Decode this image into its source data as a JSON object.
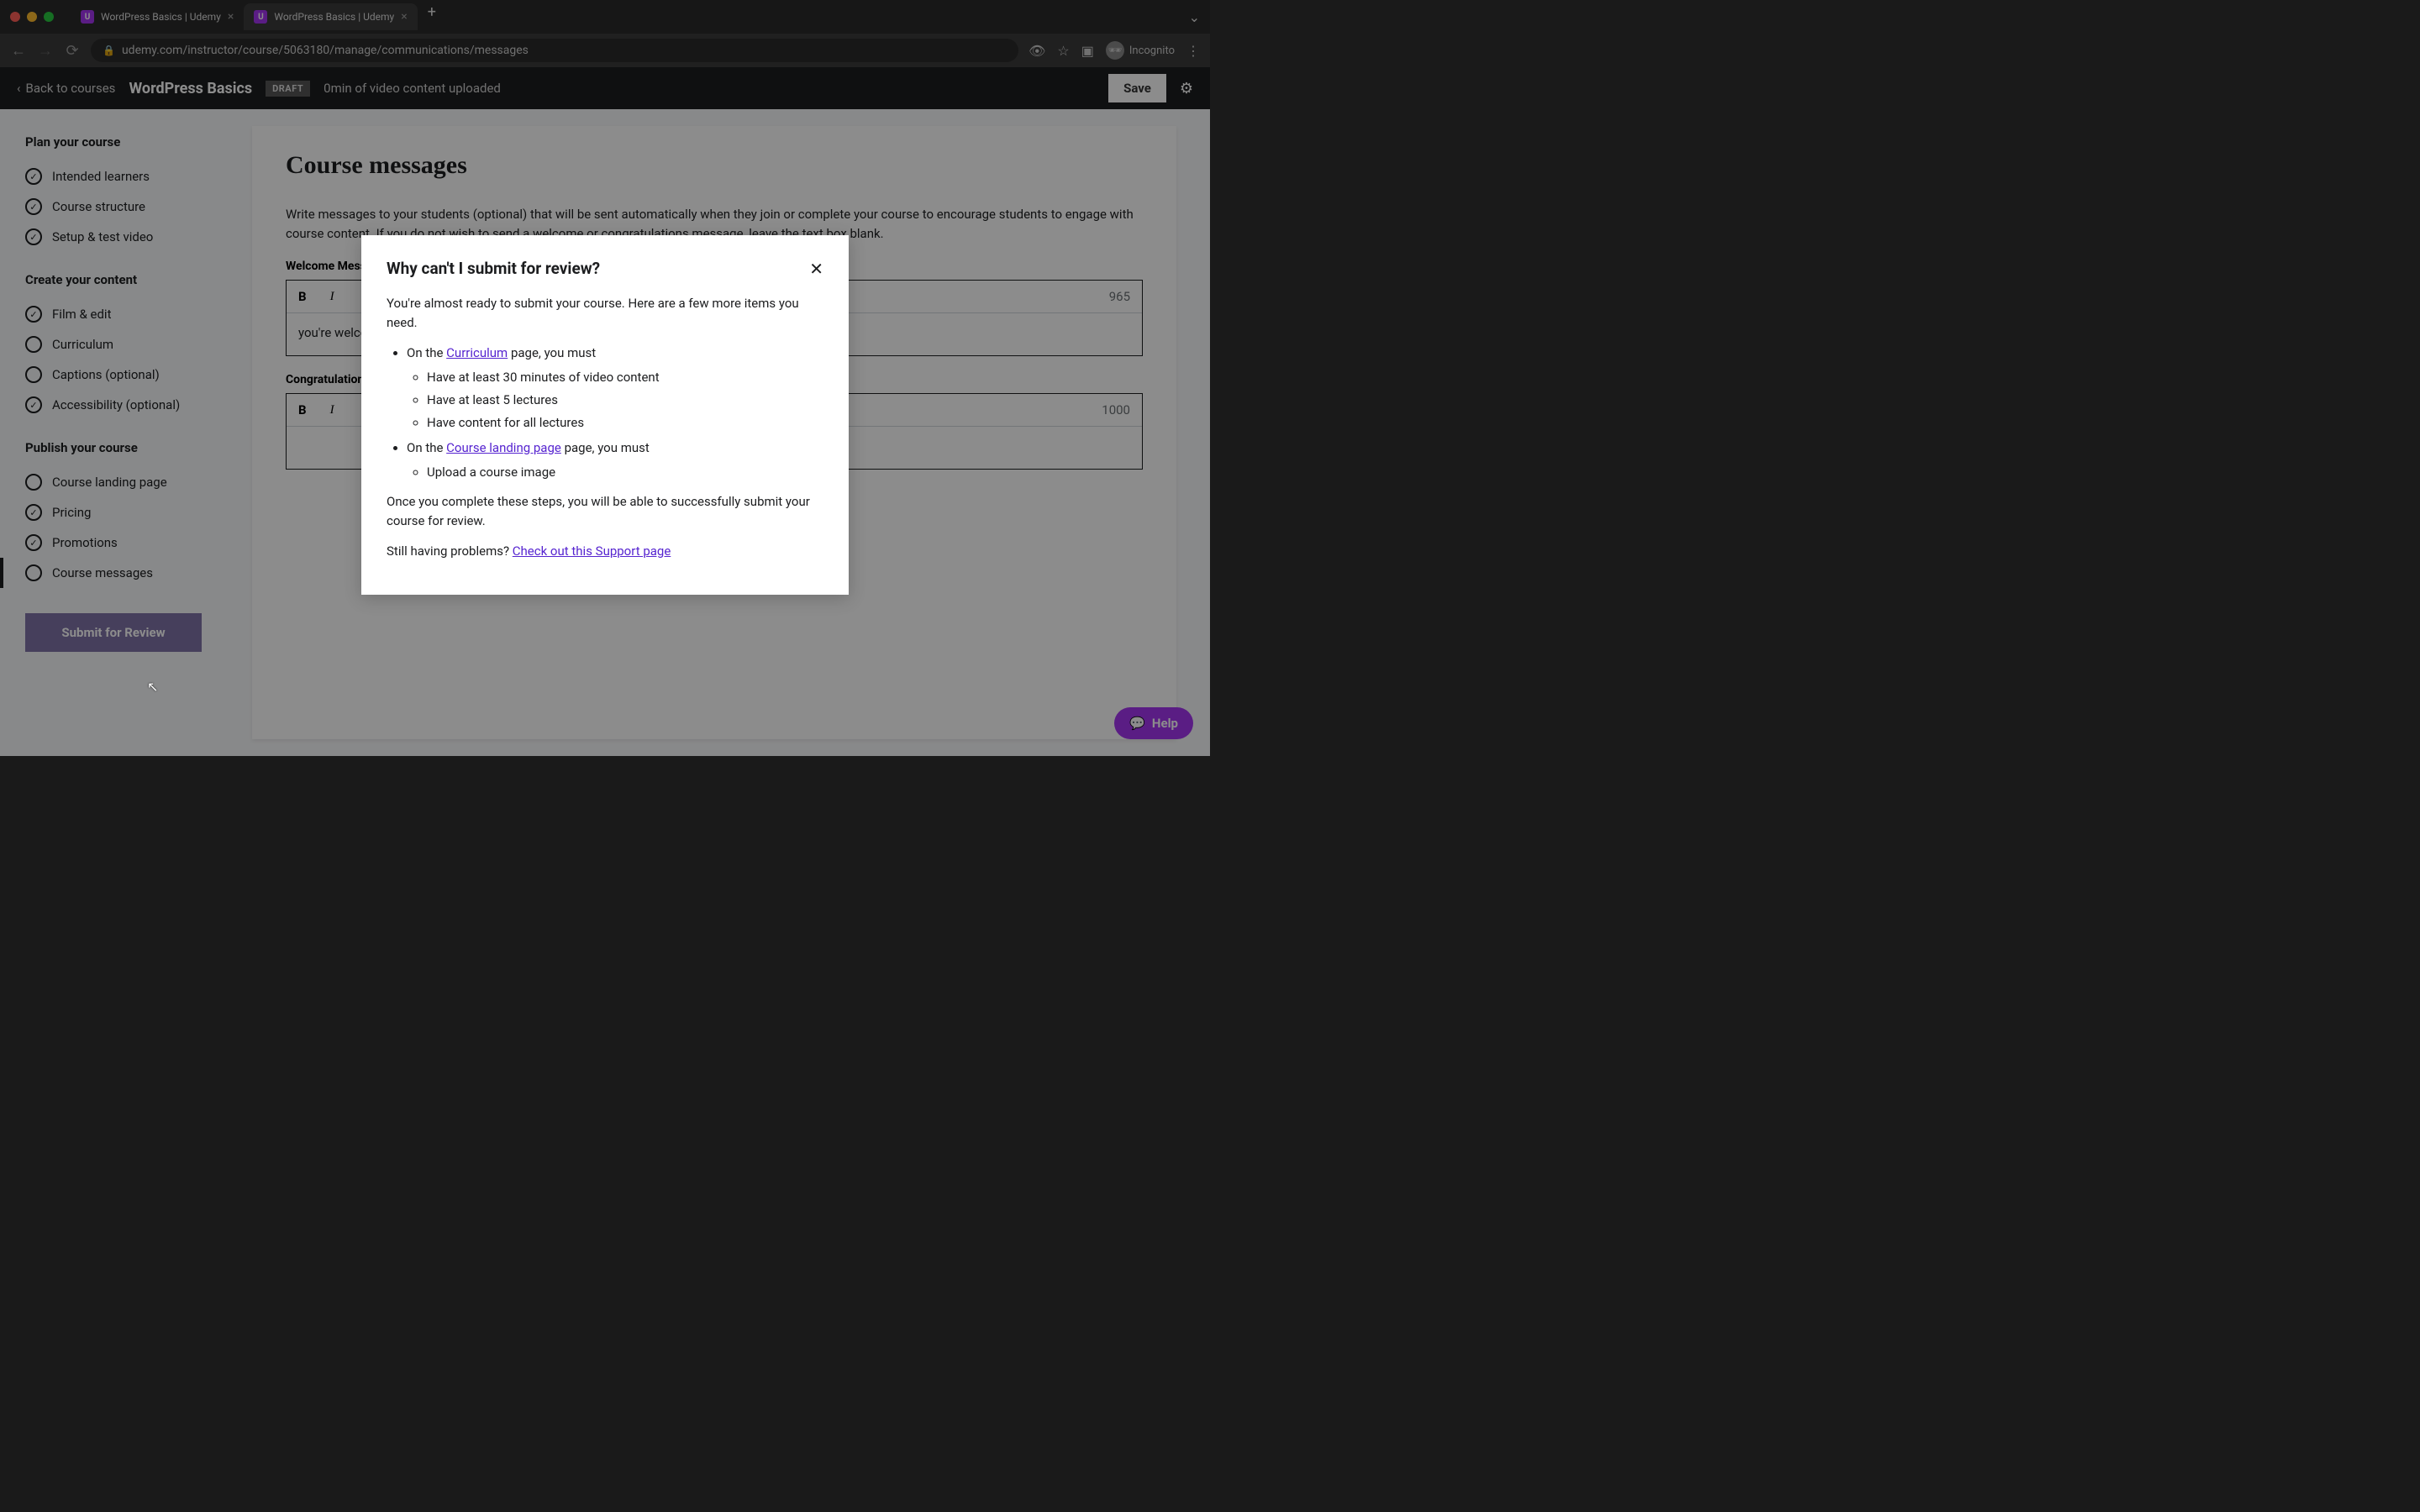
{
  "browser": {
    "tabs": [
      {
        "title": "WordPress Basics | Udemy"
      },
      {
        "title": "WordPress Basics | Udemy"
      }
    ],
    "url": "udemy.com/instructor/course/5063180/manage/communications/messages",
    "incognito_label": "Incognito"
  },
  "header": {
    "back_label": "Back to courses",
    "course_title": "WordPress Basics",
    "status_badge": "DRAFT",
    "upload_status": "0min of video content uploaded",
    "save_label": "Save"
  },
  "sidebar": {
    "sections": [
      {
        "heading": "Plan your course",
        "items": [
          {
            "label": "Intended learners",
            "checked": true
          },
          {
            "label": "Course structure",
            "checked": true
          },
          {
            "label": "Setup & test video",
            "checked": true
          }
        ]
      },
      {
        "heading": "Create your content",
        "items": [
          {
            "label": "Film & edit",
            "checked": true
          },
          {
            "label": "Curriculum",
            "checked": false
          },
          {
            "label": "Captions (optional)",
            "checked": false
          },
          {
            "label": "Accessibility (optional)",
            "checked": true
          }
        ]
      },
      {
        "heading": "Publish your course",
        "items": [
          {
            "label": "Course landing page",
            "checked": false
          },
          {
            "label": "Pricing",
            "checked": true
          },
          {
            "label": "Promotions",
            "checked": true
          },
          {
            "label": "Course messages",
            "checked": false,
            "active": true
          }
        ]
      }
    ],
    "submit_label": "Submit for Review"
  },
  "content": {
    "page_title": "Course messages",
    "intro": "Write messages to your students (optional) that will be sent automatically when they join or complete your course to encourage students to engage with course content. If you do not wish to send a welcome or congratulations message, leave the text box blank.",
    "welcome_label": "Welcome Message",
    "welcome_count": "965",
    "welcome_body": "you're welcome to this wordpress"
  },
  "congrats_label": "Congratulations Message",
  "congrats_count": "1000",
  "modal": {
    "title": "Why can't I submit for review?",
    "intro": "You're almost ready to submit your course. Here are a few more items you need.",
    "on_the_1": "On the ",
    "curriculum_link": "Curriculum",
    "page_you_must_1": " page, you must",
    "req_1": "Have at least 30 minutes of video content",
    "req_2": "Have at least 5 lectures",
    "req_3": "Have content for all lectures",
    "on_the_2": "On the ",
    "landing_link": "Course landing page",
    "page_you_must_2": " page, you must",
    "req_4": "Upload a course image",
    "once_complete": "Once you complete these steps, you will be able to successfully submit your course for review.",
    "still_having": "Still having problems? ",
    "support_link": "Check out this Support page"
  },
  "help_label": "Help",
  "toolbar_chars": {
    "B": "B",
    "I": "I"
  }
}
